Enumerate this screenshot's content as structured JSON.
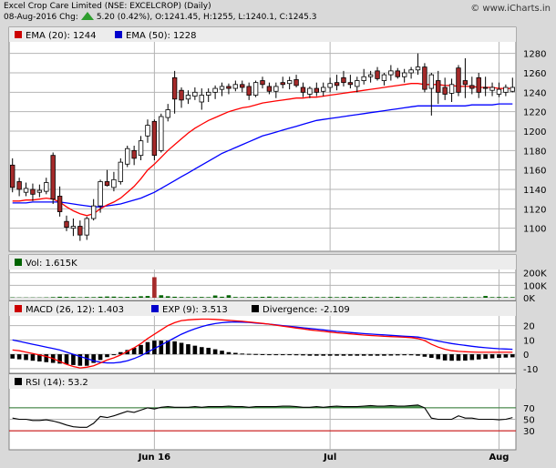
{
  "header": {
    "line1": "Excel Crop Care Limited (NSE: EXCELCROP) (Daily)",
    "line2_date": "08-Aug-2016 Chg:",
    "line2_rest": "5.20 (0.42%), O:1241.45, H:1255, L:1240.1, C:1245.3",
    "brand": "© www.iCharts.in"
  },
  "colors": {
    "up": "#ffffff",
    "down": "#a52a2a",
    "ema20": "#ff0000",
    "ema50": "#0000ff",
    "vol": "#006400",
    "rsi": "#000000",
    "rsiFill": "#2e7d32"
  },
  "chart_data": [
    {
      "type": "candlestick",
      "legend": [
        {
          "label": "EMA (20): 1244",
          "color": "#cc0000"
        },
        {
          "label": "EMA (50): 1228",
          "color": "#0000cc"
        }
      ],
      "ylim": [
        1080,
        1290
      ],
      "yticks": [
        1100,
        1120,
        1140,
        1160,
        1180,
        1200,
        1220,
        1240,
        1260,
        1280
      ],
      "xticks": [
        {
          "label": "Jun 16",
          "index": 21
        },
        {
          "label": "Jul",
          "index": 47
        },
        {
          "label": "Aug",
          "index": 72
        }
      ],
      "candles": [
        [
          1165,
          1172,
          1137,
          1142
        ],
        [
          1148,
          1152,
          1133,
          1140
        ],
        [
          1137,
          1147,
          1133,
          1141
        ],
        [
          1140,
          1146,
          1128,
          1135
        ],
        [
          1137,
          1145,
          1132,
          1139
        ],
        [
          1138,
          1152,
          1135,
          1147
        ],
        [
          1175,
          1178,
          1125,
          1130
        ],
        [
          1133,
          1143,
          1112,
          1117
        ],
        [
          1107,
          1113,
          1097,
          1101
        ],
        [
          1100,
          1110,
          1092,
          1102
        ],
        [
          1102,
          1108,
          1087,
          1093
        ],
        [
          1093,
          1112,
          1088,
          1110
        ],
        [
          1110,
          1130,
          1108,
          1123
        ],
        [
          1123,
          1150,
          1116,
          1148
        ],
        [
          1148,
          1160,
          1143,
          1144
        ],
        [
          1142,
          1158,
          1138,
          1150
        ],
        [
          1148,
          1172,
          1145,
          1168
        ],
        [
          1166,
          1185,
          1163,
          1182
        ],
        [
          1180,
          1185,
          1165,
          1172
        ],
        [
          1175,
          1195,
          1170,
          1190
        ],
        [
          1195,
          1212,
          1188,
          1206
        ],
        [
          1210,
          1212,
          1170,
          1175
        ],
        [
          1180,
          1218,
          1178,
          1215
        ],
        [
          1214,
          1228,
          1210,
          1222
        ],
        [
          1255,
          1262,
          1218,
          1233
        ],
        [
          1242,
          1245,
          1224,
          1232
        ],
        [
          1233,
          1242,
          1228,
          1237
        ],
        [
          1236,
          1245,
          1232,
          1240
        ],
        [
          1230,
          1244,
          1222,
          1237
        ],
        [
          1237,
          1244,
          1230,
          1240
        ],
        [
          1240,
          1247,
          1233,
          1244
        ],
        [
          1243,
          1250,
          1236,
          1246
        ],
        [
          1246,
          1249,
          1238,
          1244
        ],
        [
          1244,
          1252,
          1241,
          1248
        ],
        [
          1248,
          1252,
          1240,
          1245
        ],
        [
          1246,
          1250,
          1232,
          1237
        ],
        [
          1237,
          1252,
          1235,
          1250
        ],
        [
          1252,
          1256,
          1244,
          1248
        ],
        [
          1246,
          1250,
          1238,
          1241
        ],
        [
          1241,
          1250,
          1234,
          1246
        ],
        [
          1250,
          1256,
          1244,
          1248
        ],
        [
          1249,
          1256,
          1243,
          1252
        ],
        [
          1253,
          1258,
          1245,
          1247
        ],
        [
          1245,
          1250,
          1235,
          1240
        ],
        [
          1238,
          1246,
          1234,
          1244
        ],
        [
          1244,
          1250,
          1236,
          1240
        ],
        [
          1241,
          1250,
          1236,
          1245
        ],
        [
          1245,
          1255,
          1240,
          1249
        ],
        [
          1250,
          1258,
          1242,
          1247
        ],
        [
          1255,
          1262,
          1246,
          1250
        ],
        [
          1250,
          1258,
          1244,
          1248
        ],
        [
          1246,
          1256,
          1240,
          1252
        ],
        [
          1252,
          1264,
          1248,
          1256
        ],
        [
          1256,
          1262,
          1250,
          1258
        ],
        [
          1262,
          1266,
          1252,
          1254
        ],
        [
          1252,
          1260,
          1247,
          1258
        ],
        [
          1258,
          1268,
          1252,
          1262
        ],
        [
          1262,
          1265,
          1254,
          1256
        ],
        [
          1256,
          1264,
          1250,
          1260
        ],
        [
          1260,
          1266,
          1254,
          1263
        ],
        [
          1263,
          1280,
          1258,
          1266
        ],
        [
          1266,
          1270,
          1240,
          1243
        ],
        [
          1244,
          1260,
          1216,
          1258
        ],
        [
          1252,
          1262,
          1228,
          1240
        ],
        [
          1245,
          1255,
          1232,
          1238
        ],
        [
          1239,
          1254,
          1230,
          1248
        ],
        [
          1265,
          1268,
          1236,
          1240
        ],
        [
          1252,
          1275,
          1234,
          1248
        ],
        [
          1247,
          1256,
          1238,
          1244
        ],
        [
          1255,
          1260,
          1234,
          1240
        ],
        [
          1245,
          1256,
          1236,
          1244
        ],
        [
          1242,
          1250,
          1236,
          1245
        ],
        [
          1238,
          1250,
          1235,
          1243
        ],
        [
          1240,
          1248,
          1236,
          1245
        ],
        [
          1241,
          1255,
          1240,
          1245
        ]
      ],
      "ema20": [
        1128,
        1128,
        1129,
        1129,
        1130,
        1131,
        1130,
        1127,
        1122,
        1118,
        1115,
        1113,
        1115,
        1120,
        1124,
        1127,
        1131,
        1137,
        1143,
        1151,
        1160,
        1166,
        1173,
        1180,
        1186,
        1192,
        1198,
        1203,
        1207,
        1211,
        1214,
        1217,
        1220,
        1222,
        1224,
        1225,
        1227,
        1229,
        1230,
        1231,
        1232,
        1233,
        1234,
        1234,
        1235,
        1235,
        1236,
        1237,
        1238,
        1239,
        1240,
        1241,
        1242,
        1243,
        1244,
        1245,
        1246,
        1247,
        1248,
        1249,
        1249,
        1248,
        1248,
        1248,
        1247,
        1247,
        1246,
        1246,
        1246,
        1245,
        1245,
        1245,
        1244,
        1244,
        1244
      ],
      "ema50": [
        1126,
        1126,
        1126,
        1127,
        1127,
        1127,
        1127,
        1127,
        1126,
        1125,
        1124,
        1123,
        1122,
        1122,
        1123,
        1124,
        1125,
        1127,
        1129,
        1131,
        1134,
        1137,
        1141,
        1145,
        1149,
        1153,
        1157,
        1161,
        1165,
        1169,
        1173,
        1177,
        1180,
        1183,
        1186,
        1189,
        1192,
        1195,
        1197,
        1199,
        1201,
        1203,
        1205,
        1207,
        1209,
        1211,
        1212,
        1213,
        1214,
        1215,
        1216,
        1217,
        1218,
        1219,
        1220,
        1221,
        1222,
        1223,
        1224,
        1225,
        1226,
        1226,
        1226,
        1226,
        1226,
        1226,
        1226,
        1226,
        1227,
        1227,
        1227,
        1227,
        1228,
        1228,
        1228
      ]
    },
    {
      "type": "bar",
      "legend": "Vol: 1.615K",
      "ylim": [
        0,
        300
      ],
      "yticks": [
        0,
        100,
        200
      ],
      "yticklabels": [
        "0K",
        "100K",
        "200K"
      ],
      "values": [
        3,
        2,
        2,
        2,
        2,
        3,
        5,
        8,
        6,
        6,
        4,
        6,
        5,
        8,
        10,
        9,
        6,
        7,
        8,
        12,
        14,
        165,
        20,
        12,
        8,
        6,
        5,
        6,
        6,
        5,
        18,
        8,
        20,
        6,
        5,
        6,
        6,
        7,
        9,
        5,
        6,
        6,
        5,
        5,
        4,
        5,
        5,
        6,
        5,
        6,
        7,
        5,
        7,
        6,
        6,
        5,
        6,
        7,
        5,
        4,
        5,
        6,
        5,
        5,
        4,
        5,
        5,
        6,
        5,
        4,
        14,
        5,
        6,
        5,
        5
      ]
    },
    {
      "type": "line",
      "legend": [
        {
          "label": "MACD (26, 12): 1.403",
          "color": "#cc0000"
        },
        {
          "label": "EXP (9): 3.513",
          "color": "#0000cc"
        },
        {
          "label": "Divergence: -2.109",
          "color": "#000000"
        }
      ],
      "ylim": [
        -12,
        28
      ],
      "yticks": [
        -10,
        0,
        10,
        20
      ],
      "macd": [
        3,
        2.5,
        1.5,
        0.5,
        -0.5,
        -1.5,
        -3,
        -5,
        -7,
        -8.5,
        -9.5,
        -9,
        -8,
        -6,
        -4,
        -2.5,
        -0.5,
        2,
        4.5,
        7.5,
        11,
        14,
        17,
        20,
        22,
        23.5,
        24,
        24.3,
        24.5,
        24.5,
        24.3,
        24,
        23.7,
        23.3,
        23,
        22.5,
        22,
        21.5,
        21,
        20.3,
        19.6,
        19,
        18.3,
        17.7,
        17,
        16.5,
        16,
        15.5,
        15,
        14.6,
        14.2,
        13.8,
        13.4,
        13.1,
        12.8,
        12.5,
        12.3,
        12.1,
        11.9,
        11.6,
        11,
        9.5,
        7,
        5,
        3.5,
        2.5,
        2,
        1.8,
        1.6,
        1.4,
        1.4,
        1.4,
        1.4,
        1.4,
        1.4
      ],
      "exp": [
        10,
        9,
        8,
        7,
        6,
        5,
        4,
        3,
        1.5,
        0,
        -1.5,
        -3,
        -4.5,
        -5.5,
        -6,
        -6,
        -5.5,
        -4.5,
        -3,
        -1,
        1.5,
        4,
        6.5,
        9,
        11.5,
        14,
        16,
        17.8,
        19.3,
        20.5,
        21.4,
        22,
        22.4,
        22.5,
        22.4,
        22.2,
        21.8,
        21.4,
        21,
        20.5,
        20,
        19.5,
        19,
        18.5,
        18,
        17.5,
        17,
        16.5,
        16,
        15.6,
        15.2,
        14.8,
        14.4,
        14.1,
        13.8,
        13.5,
        13.2,
        12.9,
        12.6,
        12.3,
        12,
        11.2,
        10.2,
        9.2,
        8.3,
        7.5,
        6.8,
        6.2,
        5.6,
        5,
        4.6,
        4.2,
        3.9,
        3.7,
        3.5
      ],
      "div": [
        -3,
        -3.5,
        -4,
        -4.5,
        -5,
        -5.5,
        -6,
        -6.5,
        -7,
        -7.5,
        -8,
        -8,
        -6,
        -4,
        -2,
        -0.5,
        1.5,
        3,
        4.5,
        6.5,
        8.5,
        9.5,
        9.5,
        9.5,
        9,
        8,
        7,
        6,
        5,
        4.5,
        3.5,
        2.5,
        1.5,
        1,
        0.5,
        0.3,
        0.2,
        0.1,
        0,
        -0.2,
        -0.4,
        -0.5,
        -0.7,
        -0.8,
        -1,
        -1,
        -1,
        -1,
        -1,
        -1,
        -1,
        -1,
        -1,
        -1,
        -1,
        -1,
        -0.9,
        -0.8,
        -0.7,
        -0.7,
        -1,
        -1.7,
        -2.5,
        -3.4,
        -4.3,
        -4.5,
        -4.5,
        -4.4,
        -4,
        -3.6,
        -3.2,
        -2.8,
        -2.5,
        -2.3,
        -2.1
      ]
    },
    {
      "type": "line",
      "legend": "RSI (14): 53.2",
      "ylim": [
        0,
        100
      ],
      "yticks": [
        30,
        50,
        70
      ],
      "hlines": [
        30,
        70
      ],
      "rsi": [
        52,
        50,
        50,
        48,
        48,
        49,
        47,
        44,
        40,
        37,
        36,
        36,
        43,
        55,
        53,
        56,
        60,
        64,
        62,
        66,
        70,
        68,
        71,
        72,
        71,
        71,
        71,
        72,
        71,
        72,
        72,
        72,
        73,
        72,
        72,
        71,
        72,
        72,
        72,
        72,
        73,
        73,
        72,
        71,
        71,
        72,
        71,
        72,
        73,
        72,
        72,
        72,
        73,
        74,
        73,
        73,
        74,
        73,
        73,
        74,
        75,
        70,
        52,
        50,
        50,
        50,
        56,
        52,
        52,
        50,
        50,
        50,
        49,
        50,
        53
      ]
    }
  ]
}
